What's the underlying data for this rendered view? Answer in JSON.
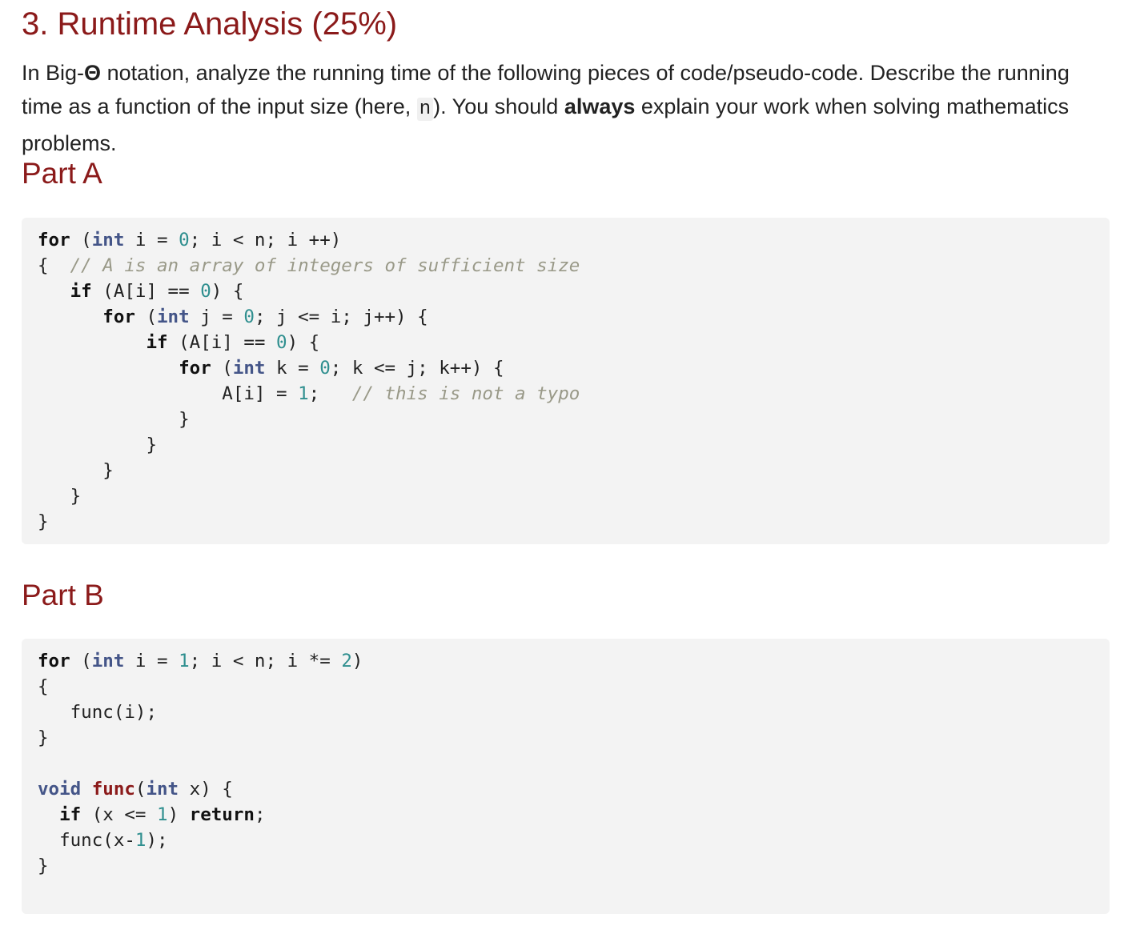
{
  "section": {
    "title": "3. Runtime Analysis (25%)"
  },
  "intro": {
    "part1": "In Big-",
    "theta": "Θ",
    "part2": " notation, analyze the running time of the following pieces of code/pseudo-code. Describe the running time as a function of the input size (here, ",
    "var": "n",
    "part3": "). You should ",
    "bold": "always",
    "part4": " explain your work when solving mathematics problems."
  },
  "parts": [
    {
      "title": "Part A",
      "code": [
        [
          [
            "kw",
            "for"
          ],
          [
            "p",
            " ("
          ],
          [
            "ty",
            "int"
          ],
          [
            "p",
            " i = "
          ],
          [
            "num",
            "0"
          ],
          [
            "p",
            "; i < n; i ++)"
          ]
        ],
        [
          [
            "p",
            "{  "
          ],
          [
            "cm",
            "// A is an array of integers of sufficient size"
          ]
        ],
        [
          [
            "p",
            "   "
          ],
          [
            "kw",
            "if"
          ],
          [
            "p",
            " (A[i] == "
          ],
          [
            "num",
            "0"
          ],
          [
            "p",
            ") {"
          ]
        ],
        [
          [
            "p",
            "      "
          ],
          [
            "kw",
            "for"
          ],
          [
            "p",
            " ("
          ],
          [
            "ty",
            "int"
          ],
          [
            "p",
            " j = "
          ],
          [
            "num",
            "0"
          ],
          [
            "p",
            "; j <= i; j++) {"
          ]
        ],
        [
          [
            "p",
            "          "
          ],
          [
            "kw",
            "if"
          ],
          [
            "p",
            " (A[i] == "
          ],
          [
            "num",
            "0"
          ],
          [
            "p",
            ") {"
          ]
        ],
        [
          [
            "p",
            "             "
          ],
          [
            "kw",
            "for"
          ],
          [
            "p",
            " ("
          ],
          [
            "ty",
            "int"
          ],
          [
            "p",
            " k = "
          ],
          [
            "num",
            "0"
          ],
          [
            "p",
            "; k <= j; k++) {"
          ]
        ],
        [
          [
            "p",
            "                 A[i] = "
          ],
          [
            "num",
            "1"
          ],
          [
            "p",
            ";   "
          ],
          [
            "cm",
            "// this is not a typo"
          ]
        ],
        [
          [
            "p",
            "             }"
          ]
        ],
        [
          [
            "p",
            "          }"
          ]
        ],
        [
          [
            "p",
            "      }"
          ]
        ],
        [
          [
            "p",
            "   }"
          ]
        ],
        [
          [
            "p",
            "}"
          ]
        ]
      ]
    },
    {
      "title": "Part B",
      "code": [
        [
          [
            "kw",
            "for"
          ],
          [
            "p",
            " ("
          ],
          [
            "ty",
            "int"
          ],
          [
            "p",
            " i = "
          ],
          [
            "num",
            "1"
          ],
          [
            "p",
            "; i < n; i *= "
          ],
          [
            "num",
            "2"
          ],
          [
            "p",
            ")"
          ]
        ],
        [
          [
            "p",
            "{"
          ]
        ],
        [
          [
            "p",
            "   func(i);"
          ]
        ],
        [
          [
            "p",
            "}"
          ]
        ],
        [
          [
            "p",
            ""
          ]
        ],
        [
          [
            "ty",
            "void"
          ],
          [
            "p",
            " "
          ],
          [
            "fn",
            "func"
          ],
          [
            "p",
            "("
          ],
          [
            "ty",
            "int"
          ],
          [
            "p",
            " x) {"
          ]
        ],
        [
          [
            "p",
            "  "
          ],
          [
            "kw",
            "if"
          ],
          [
            "p",
            " (x <= "
          ],
          [
            "num",
            "1"
          ],
          [
            "p",
            ") "
          ],
          [
            "kw",
            "return"
          ],
          [
            "p",
            ";"
          ]
        ],
        [
          [
            "p",
            "  func(x-"
          ],
          [
            "num",
            "1"
          ],
          [
            "p",
            ");"
          ]
        ],
        [
          [
            "p",
            "}"
          ]
        ]
      ]
    }
  ]
}
